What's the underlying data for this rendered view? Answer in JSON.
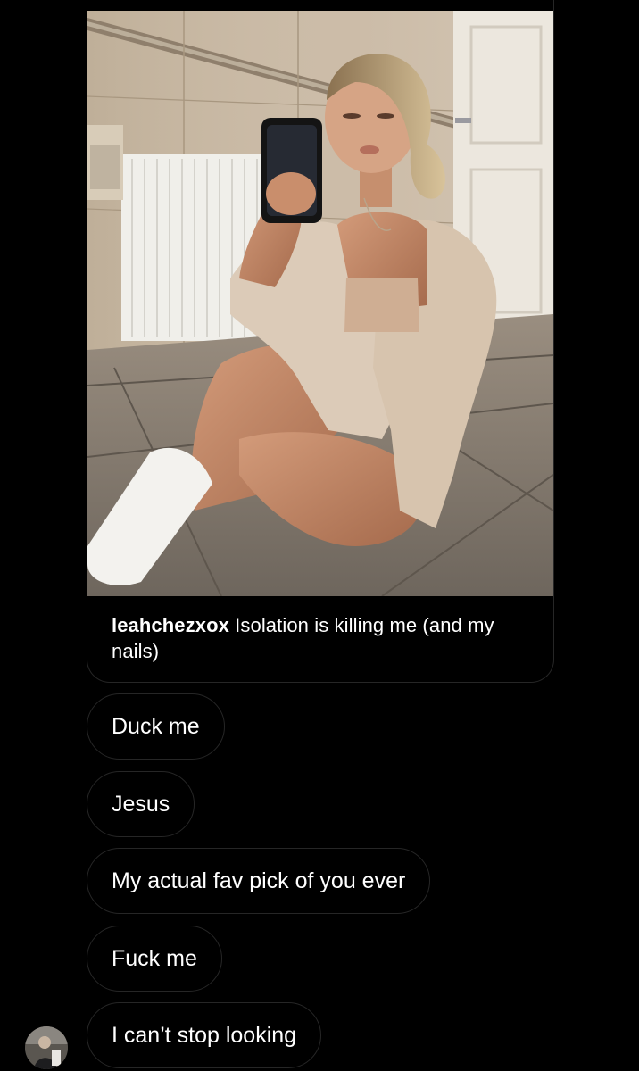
{
  "shared_post": {
    "username": "leahchezxox",
    "caption": " Isolation is killing me (and my nails)"
  },
  "messages": [
    {
      "text": "Duck me"
    },
    {
      "text": "Jesus"
    },
    {
      "text": "My actual fav pick of you ever"
    },
    {
      "text": "Fuck me"
    },
    {
      "text": "I can’t stop looking"
    }
  ],
  "sender": {
    "avatar": "profile-avatar"
  },
  "colors": {
    "background": "#000000",
    "bubble_border": "#262626",
    "text": "#ffffff"
  }
}
